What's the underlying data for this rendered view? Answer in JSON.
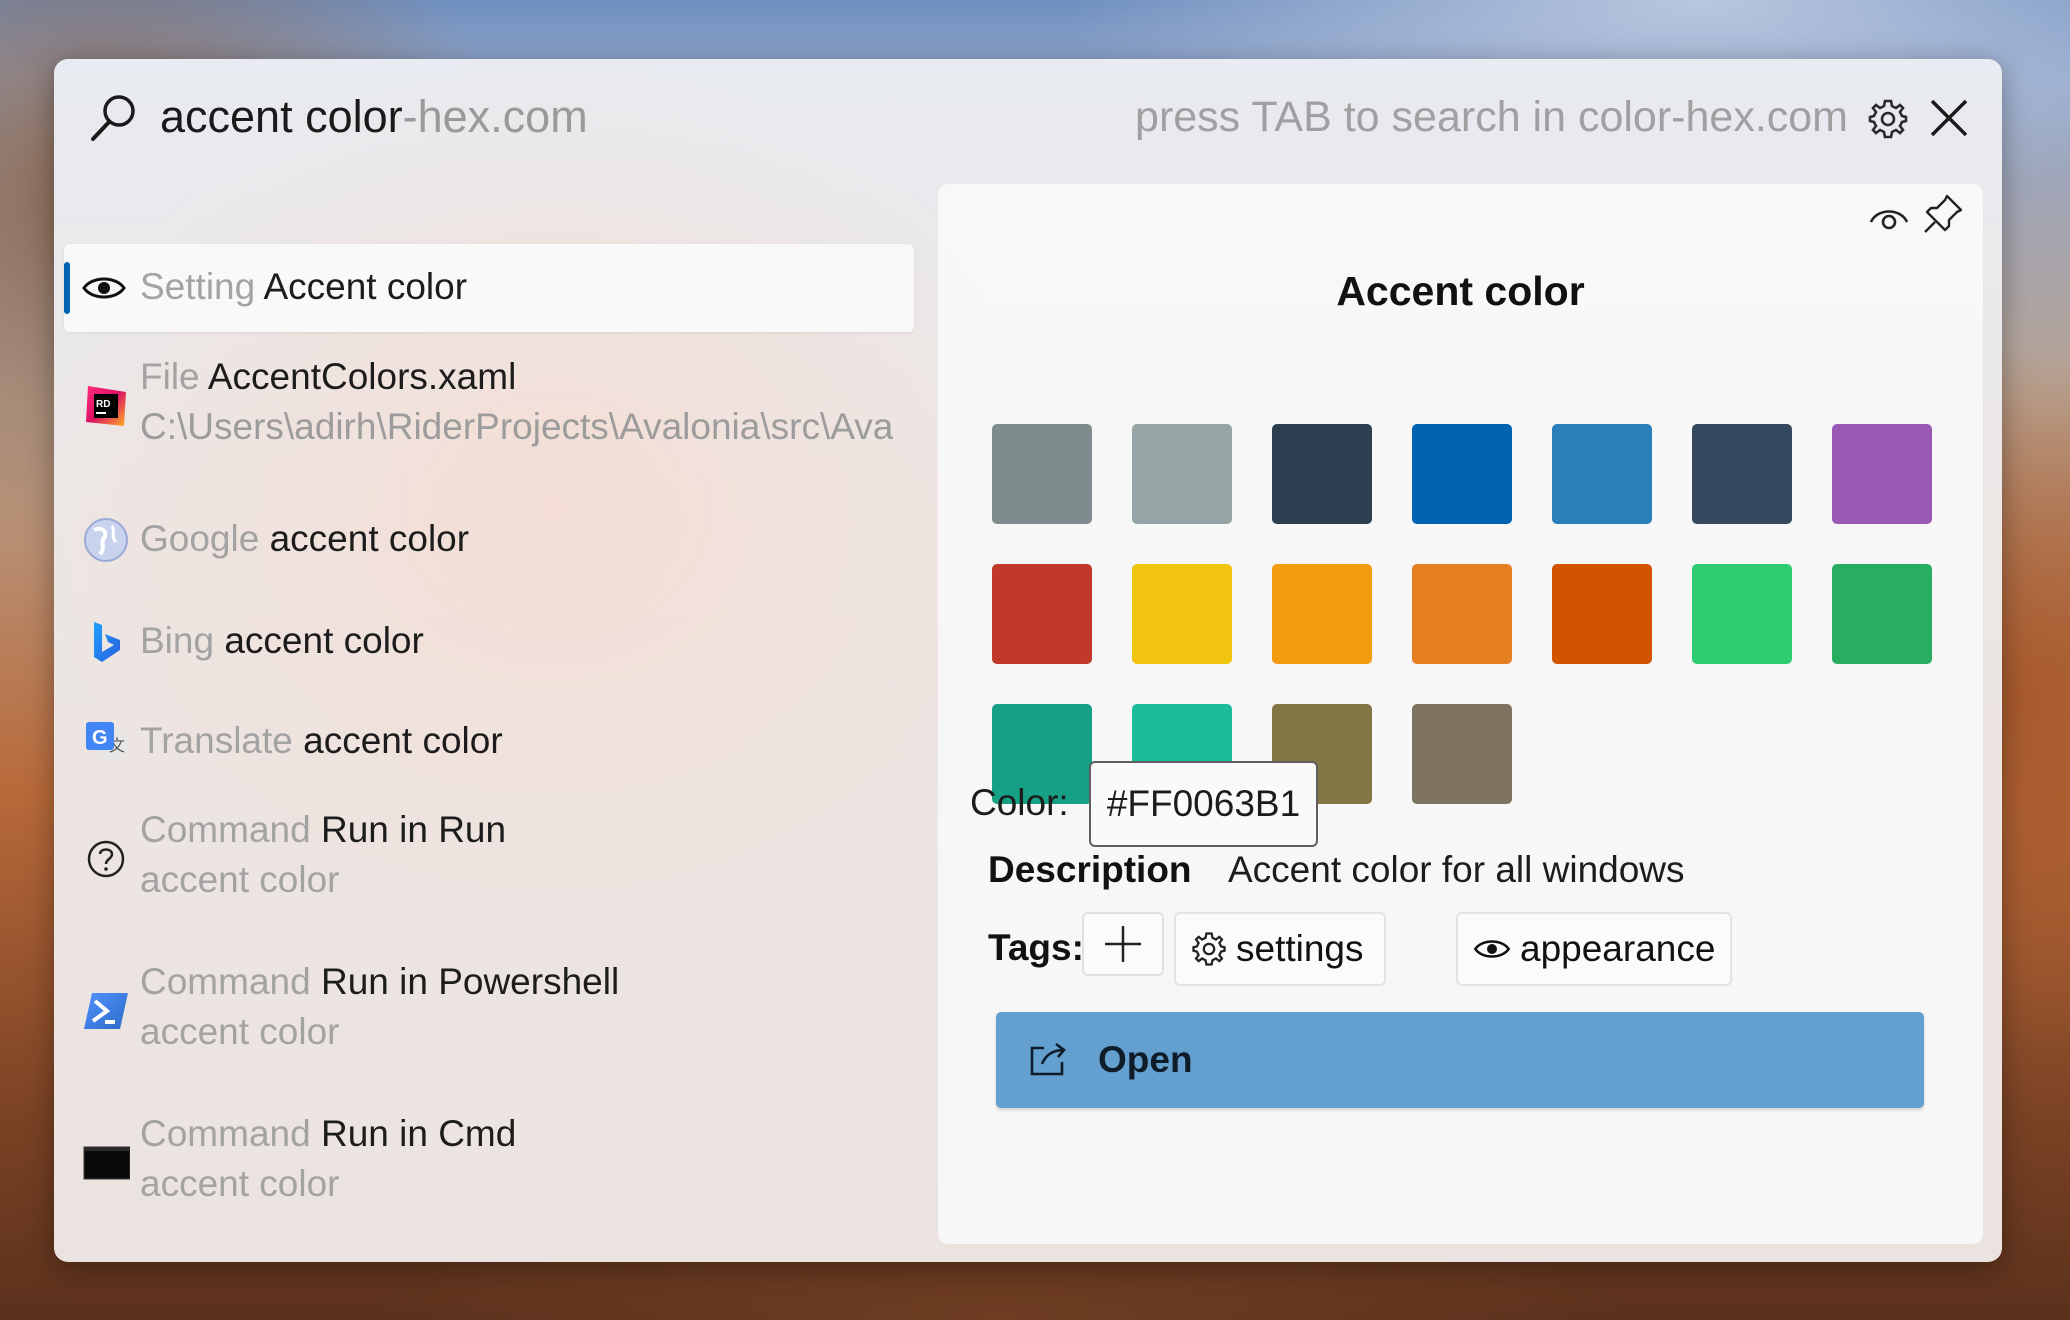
{
  "search": {
    "query": "accent color",
    "suggestion_suffix": "-hex.com",
    "hint": "press TAB to search in color-hex.com",
    "icons": [
      "search-icon",
      "gear-icon",
      "close-icon"
    ]
  },
  "results": [
    {
      "icon": "eye-icon",
      "category": "Setting",
      "title": "Accent color",
      "selected": true
    },
    {
      "icon": "rider-icon",
      "category": "File",
      "title": "AccentColors.xaml",
      "subtitle": "C:\\Users\\adirh\\RiderProjects\\Avalonia\\src\\Ava"
    },
    {
      "icon": "globe-icon",
      "category": "Google",
      "title": "accent color"
    },
    {
      "icon": "bing-icon",
      "category": "Bing",
      "title": "accent color"
    },
    {
      "icon": "translate-icon",
      "category": "Translate",
      "title": "accent color"
    },
    {
      "icon": "question-icon",
      "category": "Command",
      "title": "Run in Run",
      "subtitle": "accent color"
    },
    {
      "icon": "powershell-icon",
      "category": "Command",
      "title": "Run in Powershell",
      "subtitle": "accent color"
    },
    {
      "icon": "cmd-icon",
      "category": "Command",
      "title": "Run in Cmd",
      "subtitle": "accent color"
    }
  ],
  "preview": {
    "title": "Accent color",
    "icons": [
      "eye-icon",
      "pin-icon"
    ],
    "swatches": [
      "#7f8c8d",
      "#95a5a6",
      "#2c3e50",
      "#0063b1",
      "#2980b9",
      "#34495e",
      "#9b59b6",
      "#c0392b",
      "#f1c40f",
      "#f39c12",
      "#e67e22",
      "#d35400",
      "#2ecc71",
      "#27ae60",
      "#16a085",
      "#1abc9c",
      "#847545",
      "#7e735f"
    ],
    "color_label": "Color:",
    "color_value": "#FF0063B1",
    "description_label": "Description",
    "description_value": "Accent color for all windows",
    "tags_label": "Tags:",
    "tags": [
      {
        "icon": "gear-icon",
        "label": "settings"
      },
      {
        "icon": "eye-icon",
        "label": "appearance"
      }
    ],
    "open_label": "Open"
  },
  "colors": {
    "accent": "#0063b1",
    "open_button": "#64a0cf"
  }
}
